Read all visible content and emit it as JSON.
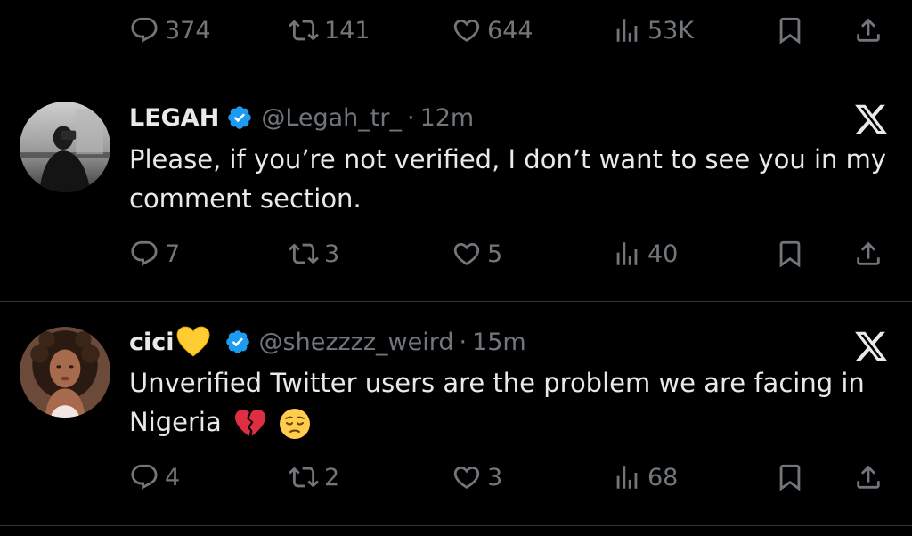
{
  "top_actions": {
    "replies": "374",
    "retweets": "141",
    "likes": "644",
    "views": "53K"
  },
  "tweets": [
    {
      "name": "LEGAH",
      "handle": "@Legah_tr_",
      "separator": "·",
      "time": "12m",
      "text": "Please, if you’re not verified, I don’t want to see you in my comment section.",
      "actions": {
        "replies": "7",
        "retweets": "3",
        "likes": "5",
        "views": "40"
      }
    },
    {
      "name": "cici",
      "name_emoji": "yellow-heart-emoji",
      "handle": "@shezzzz_weird",
      "separator": "·",
      "time": "15m",
      "text": "Unverified Twitter users are the problem we are facing in Nigeria",
      "text_emojis": [
        "broken-heart-emoji",
        "pensive-face-emoji"
      ],
      "actions": {
        "replies": "4",
        "retweets": "2",
        "likes": "3",
        "views": "68"
      }
    }
  ],
  "colors": {
    "background": "#000000",
    "text": "#e7e9ea",
    "muted": "#71767b",
    "divider": "#2f3336",
    "verified": "#1d9bf0"
  }
}
